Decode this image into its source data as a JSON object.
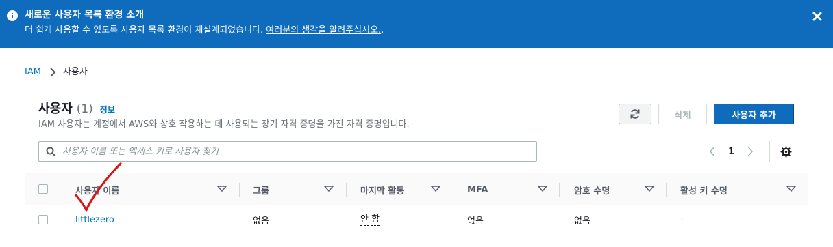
{
  "banner": {
    "title": "새로운 사용자 목록 환경 소개",
    "text": "더 쉽게 사용할 수 있도록 사용자 목록 환경이 재설계되었습니다. ",
    "link": "여러분의 생각을 알려주십시오.",
    "suffix": ".",
    "icon": "info-icon",
    "close_icon": "close-icon"
  },
  "breadcrumb": {
    "root": "IAM",
    "current": "사용자"
  },
  "panel": {
    "title": "사용자",
    "count": "(1)",
    "info": "정보",
    "description": "IAM 사용자는 계정에서 AWS와 상호 작용하는 데 사용되는 장기 자격 증명을 가진 자격 증명입니다."
  },
  "buttons": {
    "refresh_icon": "refresh-icon",
    "delete": "삭제",
    "add_user": "사용자 추가"
  },
  "search": {
    "placeholder": "사용자 이름 또는 액세스 키로 사용자 찾기"
  },
  "pagination": {
    "page": "1"
  },
  "table": {
    "columns": [
      "사용자 이름",
      "그룹",
      "마지막 활동",
      "MFA",
      "암호 수명",
      "활성 키 수명"
    ],
    "rows": [
      {
        "user_name": "littlezero",
        "groups": "없음",
        "last_activity": "안 함",
        "mfa": "없음",
        "password_age": "없음",
        "active_key_age": "-"
      }
    ]
  },
  "colors": {
    "banner": "#0f6cbd",
    "link": "#0073bb",
    "primary": "#0f6cbd",
    "annotation": "#d91515"
  }
}
